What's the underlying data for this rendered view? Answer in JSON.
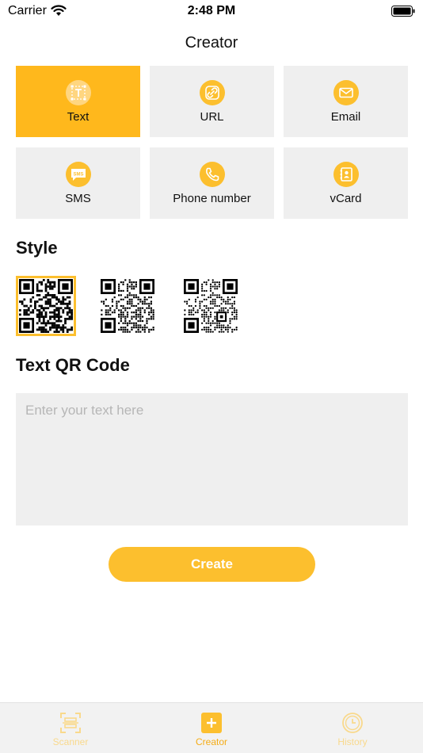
{
  "status_bar": {
    "carrier": "Carrier",
    "time": "2:48 PM"
  },
  "nav": {
    "title": "Creator"
  },
  "types": [
    {
      "label": "Text",
      "icon": "text-icon",
      "selected": true
    },
    {
      "label": "URL",
      "icon": "link-icon",
      "selected": false
    },
    {
      "label": "Email",
      "icon": "email-icon",
      "selected": false
    },
    {
      "label": "SMS",
      "icon": "sms-icon",
      "selected": false
    },
    {
      "label": "Phone number",
      "icon": "phone-icon",
      "selected": false
    },
    {
      "label": "vCard",
      "icon": "vcard-icon",
      "selected": false
    }
  ],
  "style_section": {
    "title": "Style",
    "selected_index": 0
  },
  "input_section": {
    "title": "Text QR Code",
    "placeholder": "Enter your text here",
    "value": ""
  },
  "create_button": {
    "label": "Create"
  },
  "sms_icon_text": "SMS",
  "tabs": [
    {
      "label": "Scanner",
      "icon": "scanner-icon",
      "active": false
    },
    {
      "label": "Creator",
      "icon": "plus-icon",
      "active": true
    },
    {
      "label": "History",
      "icon": "clock-icon",
      "active": false
    }
  ],
  "colors": {
    "accent": "#fcbf2e",
    "selected_card": "#ffb81c",
    "card_bg": "#efefef",
    "tab_inactive": "#f9d98c"
  }
}
